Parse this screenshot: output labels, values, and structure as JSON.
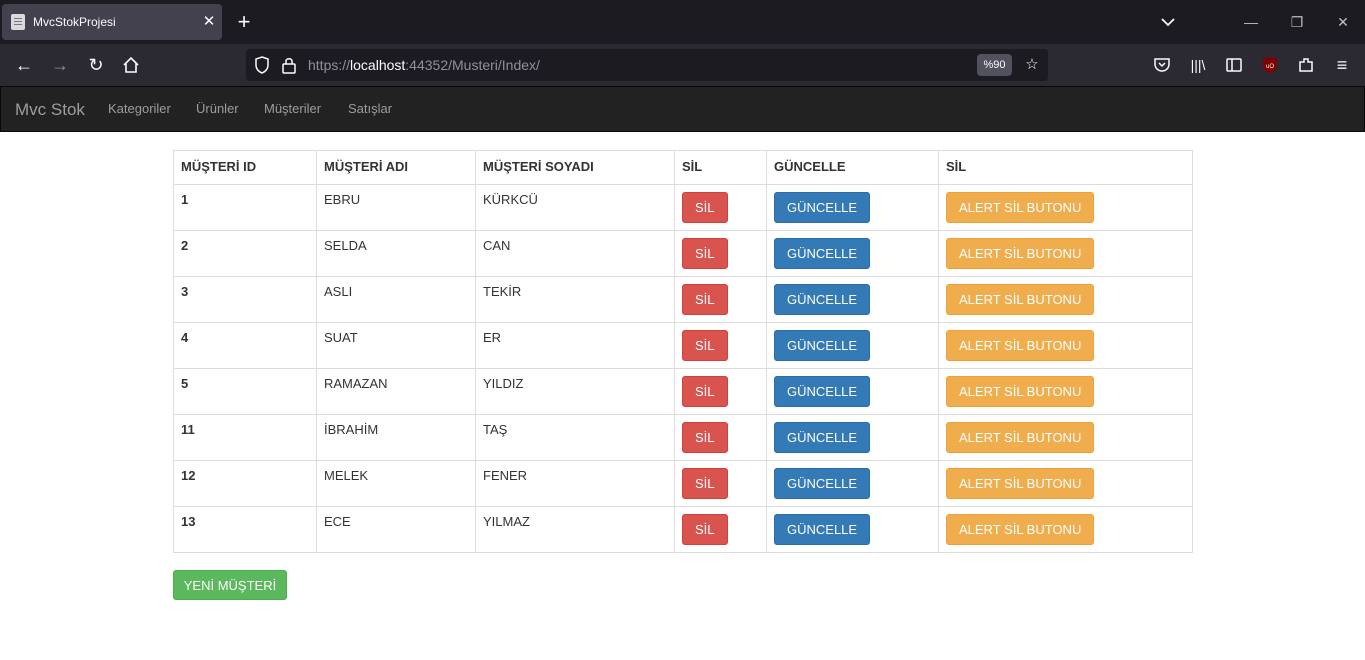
{
  "browser": {
    "tab_title": "MvcStokProjesi",
    "url_scheme": "https://",
    "url_host": "localhost",
    "url_path": ":44352/Musteri/Index/",
    "zoom": "%90"
  },
  "site": {
    "brand": "Mvc Stok",
    "nav": [
      "Kategoriler",
      "Ürünler",
      "Müşteriler",
      "Satışlar"
    ]
  },
  "table": {
    "headers": [
      "MÜŞTERİ ID",
      "MÜŞTERİ ADI",
      "MÜŞTERİ SOYADI",
      "SİL",
      "GÜNCELLE",
      "SİL"
    ],
    "delete_label": "SİL",
    "update_label": "GÜNCELLE",
    "alert_label": "ALERT SİL BUTONU",
    "rows": [
      {
        "id": "1",
        "name": "EBRU",
        "surname": "KÜRKCÜ"
      },
      {
        "id": "2",
        "name": "SELDA",
        "surname": "CAN"
      },
      {
        "id": "3",
        "name": "ASLI",
        "surname": "TEKİR"
      },
      {
        "id": "4",
        "name": "SUAT",
        "surname": "ER"
      },
      {
        "id": "5",
        "name": "RAMAZAN",
        "surname": "YILDIZ"
      },
      {
        "id": "11",
        "name": "İBRAHİM",
        "surname": "TAŞ"
      },
      {
        "id": "12",
        "name": "MELEK",
        "surname": "FENER"
      },
      {
        "id": "13",
        "name": "ECE",
        "surname": "YILMAZ"
      }
    ]
  },
  "new_customer_label": "YENİ MÜŞTERİ",
  "colors": {
    "danger": "#d9534f",
    "primary": "#337ab7",
    "warning": "#f0ad4e",
    "success": "#5cb85c"
  }
}
